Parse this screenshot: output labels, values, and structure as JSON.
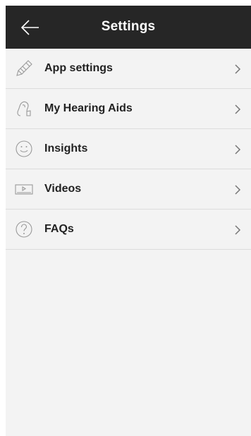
{
  "header": {
    "title": "Settings",
    "back_icon": "arrow-left-icon"
  },
  "colors": {
    "header_bg": "#262626",
    "header_text": "#ffffff",
    "list_bg": "#f3f3f3",
    "divider": "#dcdcdc",
    "label_text": "#222222",
    "icon_stroke": "#9a9a9a"
  },
  "menu": {
    "items": [
      {
        "label": "App settings",
        "icon": "pencil-icon"
      },
      {
        "label": "My Hearing Aids",
        "icon": "hearing-aid-icon"
      },
      {
        "label": "Insights",
        "icon": "smiley-icon"
      },
      {
        "label": "Videos",
        "icon": "video-icon"
      },
      {
        "label": "FAQs",
        "icon": "question-icon"
      }
    ],
    "chevron_icon": "chevron-right-icon"
  }
}
